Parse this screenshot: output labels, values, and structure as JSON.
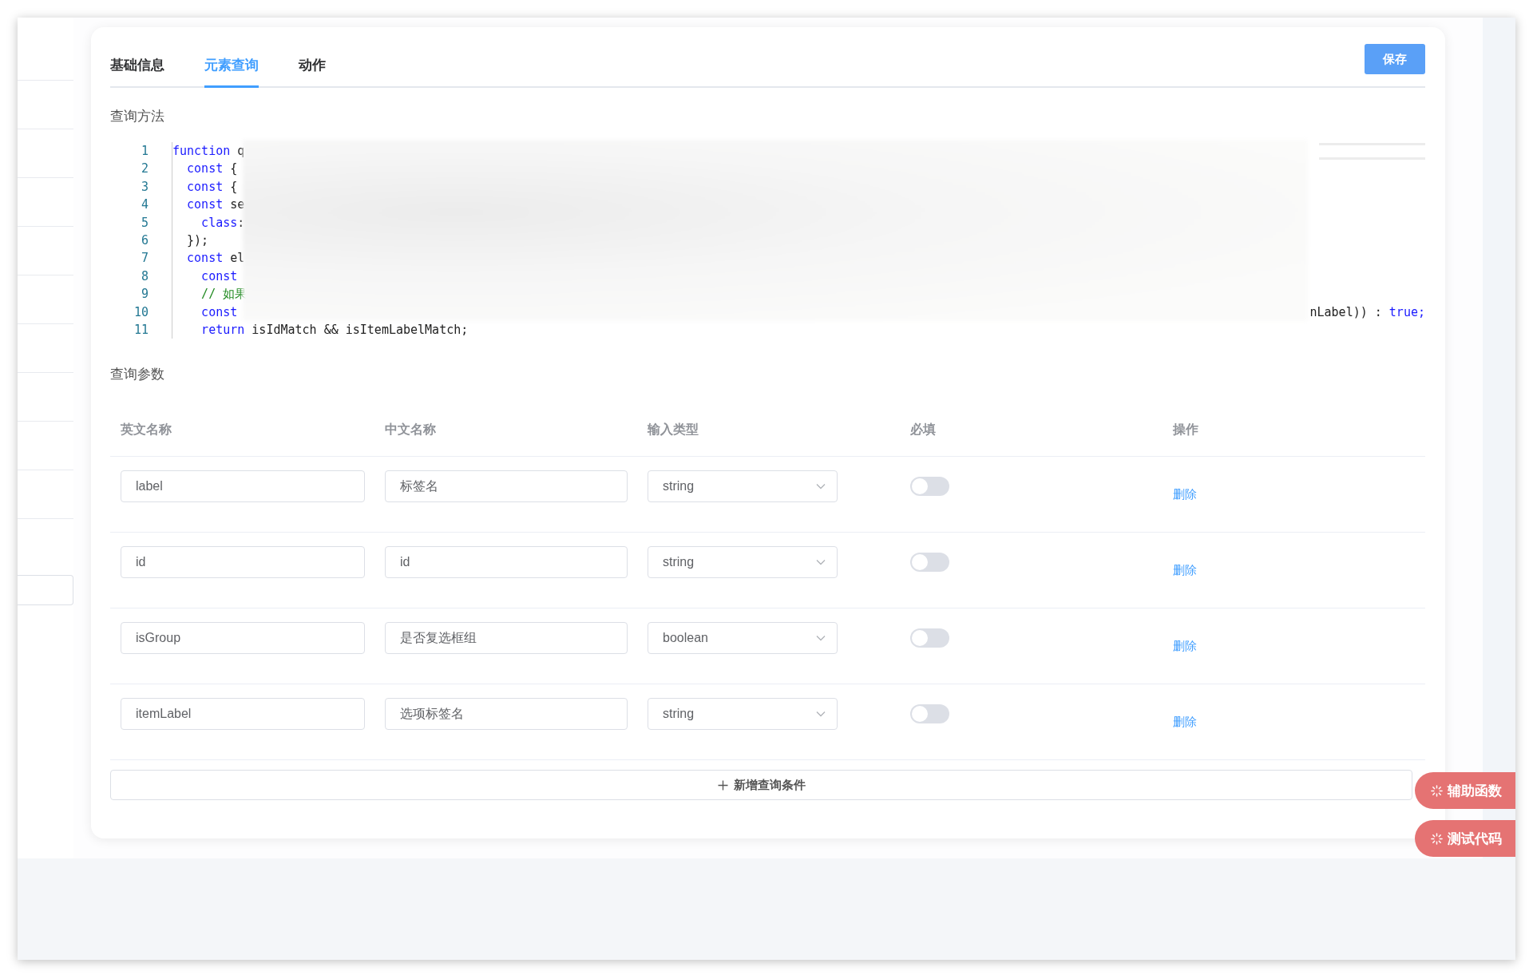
{
  "tabs": [
    {
      "label": "基础信息",
      "selected": false
    },
    {
      "label": "元素查询",
      "selected": true
    },
    {
      "label": "动作",
      "selected": false
    }
  ],
  "save_button": "保存",
  "query_method": {
    "title": "查询方法",
    "code_lines": [
      {
        "number": "1",
        "code": [
          {
            "text": "function",
            "kind": "keyword"
          },
          {
            "text": " q",
            "kind": "plain"
          }
        ]
      },
      {
        "number": "2",
        "code": [
          {
            "text": "  const",
            "kind": "keyword"
          },
          {
            "text": " {",
            "kind": "plain"
          }
        ]
      },
      {
        "number": "3",
        "code": [
          {
            "text": "  const",
            "kind": "keyword"
          },
          {
            "text": " {",
            "kind": "plain"
          }
        ]
      },
      {
        "number": "4",
        "code": [
          {
            "text": "  const",
            "kind": "keyword"
          },
          {
            "text": " se",
            "kind": "plain"
          }
        ]
      },
      {
        "number": "5",
        "code": [
          {
            "text": "    class",
            "kind": "keyword"
          },
          {
            "text": ":",
            "kind": "plain"
          }
        ]
      },
      {
        "number": "6",
        "code": [
          {
            "text": "  });",
            "kind": "plain"
          }
        ]
      },
      {
        "number": "7",
        "code": [
          {
            "text": "  const",
            "kind": "keyword"
          },
          {
            "text": " el",
            "kind": "plain"
          }
        ]
      },
      {
        "number": "8",
        "code": [
          {
            "text": "    const",
            "kind": "keyword"
          }
        ]
      },
      {
        "number": "9",
        "code": [
          {
            "text": "    // 如果",
            "kind": "comment"
          }
        ]
      },
      {
        "number": "10",
        "code": [
          {
            "text": "    const",
            "kind": "keyword"
          }
        ],
        "tail": [
          {
            "text": "nLabel)) : ",
            "kind": "plain"
          },
          {
            "text": "true;",
            "kind": "keyword"
          }
        ]
      },
      {
        "number": "11",
        "code": [
          {
            "text": "    return",
            "kind": "keyword"
          },
          {
            "text": " isIdMatch && isItemLabelMatch;",
            "kind": "plain"
          }
        ]
      }
    ]
  },
  "query_params": {
    "title": "查询参数",
    "columns": [
      "英文名称",
      "中文名称",
      "输入类型",
      "必填",
      "操作"
    ],
    "rows": [
      {
        "en_name": "label",
        "zh_name": "标签名",
        "input_type": "string",
        "required": false,
        "action": "删除"
      },
      {
        "en_name": "id",
        "zh_name": "id",
        "input_type": "string",
        "required": false,
        "action": "删除"
      },
      {
        "en_name": "isGroup",
        "zh_name": "是否复选框组",
        "input_type": "boolean",
        "required": false,
        "action": "删除"
      },
      {
        "en_name": "itemLabel",
        "zh_name": "选项标签名",
        "input_type": "string",
        "required": false,
        "action": "删除"
      }
    ],
    "add_button": "新增查询条件"
  },
  "floating_buttons": [
    "辅助函数",
    "测试代码"
  ]
}
